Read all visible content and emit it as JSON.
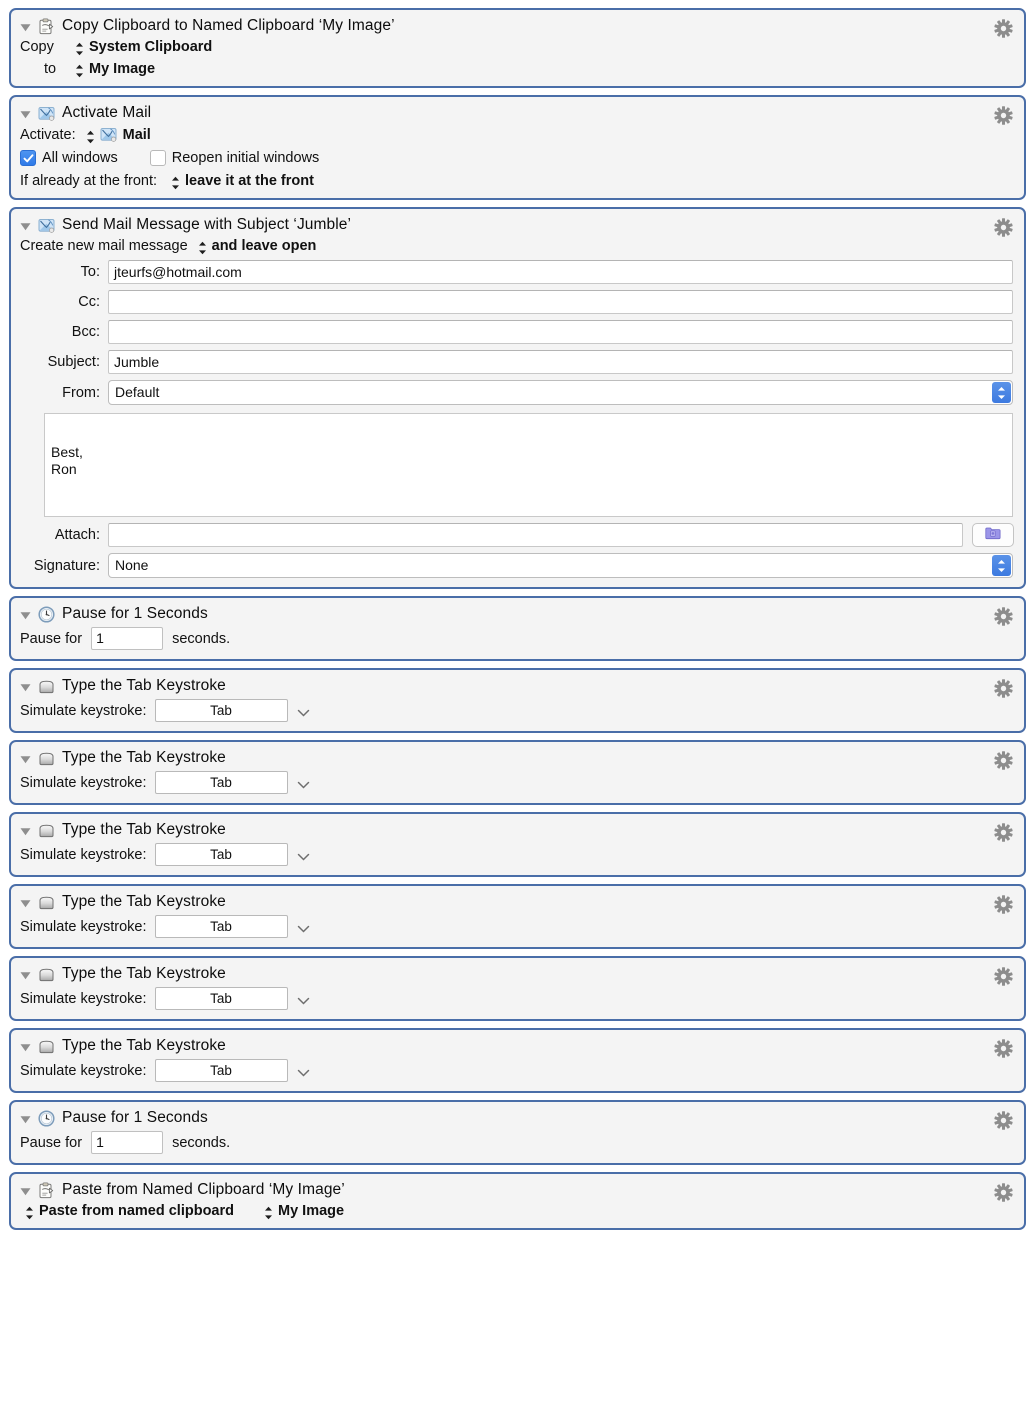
{
  "actions": [
    {
      "type": "copy-clipboard",
      "icon": "clipboard-icon",
      "title": "Copy Clipboard to Named Clipboard ‘My Image’",
      "rows": [
        {
          "label": "Copy",
          "value": "System Clipboard"
        },
        {
          "label": "to",
          "value": "My Image"
        }
      ]
    },
    {
      "type": "activate-app",
      "icon": "mail-app-icon",
      "title": "Activate Mail",
      "activate_label": "Activate:",
      "activate_value": "Mail",
      "checkbox_all_windows": {
        "label": "All windows",
        "checked": true
      },
      "checkbox_reopen": {
        "label": "Reopen initial windows",
        "checked": false
      },
      "front_label": "If already at the front:",
      "front_value": "leave it at the front"
    },
    {
      "type": "send-mail",
      "icon": "mail-app-icon",
      "title": "Send Mail Message with Subject ‘Jumble’",
      "create_label": "Create new mail message",
      "create_value": "and leave open",
      "fields": [
        {
          "label": "To:",
          "value": "jteurfs@hotmail.com"
        },
        {
          "label": "Cc:",
          "value": ""
        },
        {
          "label": "Bcc:",
          "value": ""
        },
        {
          "label": "Subject:",
          "value": "Jumble"
        }
      ],
      "from": {
        "label": "From:",
        "value": "Default"
      },
      "body": "Best,\nRon",
      "attach": {
        "label": "Attach:",
        "value": "",
        "button_icon": "folder-icon"
      },
      "signature": {
        "label": "Signature:",
        "value": "None"
      }
    },
    {
      "type": "pause",
      "icon": "clock-icon",
      "title": "Pause for 1 Seconds",
      "prefix": "Pause for",
      "value": "1",
      "suffix": "seconds."
    },
    {
      "type": "keystroke",
      "icon": "keycap-icon",
      "title": "Type the Tab Keystroke",
      "label": "Simulate keystroke:",
      "value": "Tab"
    },
    {
      "type": "keystroke",
      "icon": "keycap-icon",
      "title": "Type the Tab Keystroke",
      "label": "Simulate keystroke:",
      "value": "Tab"
    },
    {
      "type": "keystroke",
      "icon": "keycap-icon",
      "title": "Type the Tab Keystroke",
      "label": "Simulate keystroke:",
      "value": "Tab"
    },
    {
      "type": "keystroke",
      "icon": "keycap-icon",
      "title": "Type the Tab Keystroke",
      "label": "Simulate keystroke:",
      "value": "Tab"
    },
    {
      "type": "keystroke",
      "icon": "keycap-icon",
      "title": "Type the Tab Keystroke",
      "label": "Simulate keystroke:",
      "value": "Tab"
    },
    {
      "type": "keystroke",
      "icon": "keycap-icon",
      "title": "Type the Tab Keystroke",
      "label": "Simulate keystroke:",
      "value": "Tab"
    },
    {
      "type": "pause",
      "icon": "clock-icon",
      "title": "Pause for 1 Seconds",
      "prefix": "Pause for",
      "value": "1",
      "suffix": "seconds."
    },
    {
      "type": "paste-clipboard",
      "icon": "clipboard-icon",
      "title": "Paste from Named Clipboard ‘My Image’",
      "action_value": "Paste from named clipboard",
      "clipboard_value": "My Image"
    }
  ],
  "colors": {
    "panel_border": "#4a6ea8",
    "panel_bg": "#f4f4f4",
    "accent_blue": "#3d7ae0",
    "gear_gray": "#8a8a8a"
  }
}
